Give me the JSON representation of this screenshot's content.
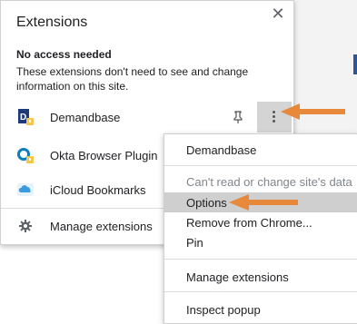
{
  "popup": {
    "title": "Extensions",
    "section_heading": "No access needed",
    "section_description": "These extensions don't need to see and change information on this site.",
    "extensions": [
      {
        "label": "Demandbase"
      },
      {
        "label": "Okta Browser Plugin"
      },
      {
        "label": "iCloud Bookmarks"
      }
    ],
    "manage_label": "Manage extensions"
  },
  "context_menu": {
    "items": [
      {
        "label": "Demandbase"
      },
      {
        "label": "Can't read or change site's data"
      },
      {
        "label": "Options"
      },
      {
        "label": "Remove from Chrome..."
      },
      {
        "label": "Pin"
      },
      {
        "label": "Manage extensions"
      },
      {
        "label": "Inspect popup"
      }
    ]
  },
  "colors": {
    "arrow": "#e8883a",
    "highlight": "#cfcfcf",
    "demandbase_brand": "#1f3a7a",
    "okta_brand": "#0a7cc1",
    "icloud_brand": "#3a9be0",
    "badge_yellow": "#f6c54a"
  }
}
